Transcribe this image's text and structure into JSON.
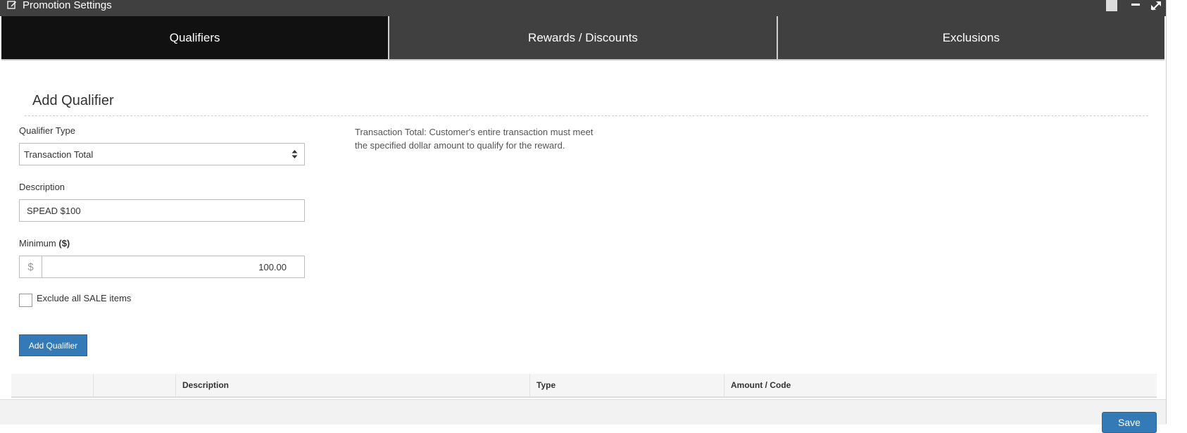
{
  "window": {
    "title": "Promotion Settings",
    "icons": [
      "edit-icon",
      "square-icon",
      "minimize-icon",
      "expand-icon"
    ]
  },
  "tabs": [
    {
      "label": "Qualifiers",
      "active": true
    },
    {
      "label": "Rewards / Discounts",
      "active": false
    },
    {
      "label": "Exclusions",
      "active": false
    }
  ],
  "form": {
    "section_title": "Add Qualifier",
    "qualifier_type": {
      "label": "Qualifier Type",
      "value": "Transaction Total"
    },
    "description": {
      "label": "Description",
      "value": "SPEAD $100"
    },
    "minimum": {
      "label": "Minimum",
      "unit": "($)",
      "prefix": "$",
      "value": "100.00"
    },
    "exclude_sale": {
      "label": "Exclude all SALE items",
      "checked": false
    },
    "add_button": "Add Qualifier"
  },
  "help_text": "Transaction Total: Customer's entire transaction must meet the specified dollar amount to qualify for the reward.",
  "table": {
    "columns": [
      "",
      "",
      "Description",
      "Type",
      "Amount / Code"
    ]
  },
  "footer": {
    "save_label": "Save"
  },
  "colors": {
    "accent": "#337ab7",
    "titlebar": "#404040",
    "active_tab": "#111111"
  }
}
